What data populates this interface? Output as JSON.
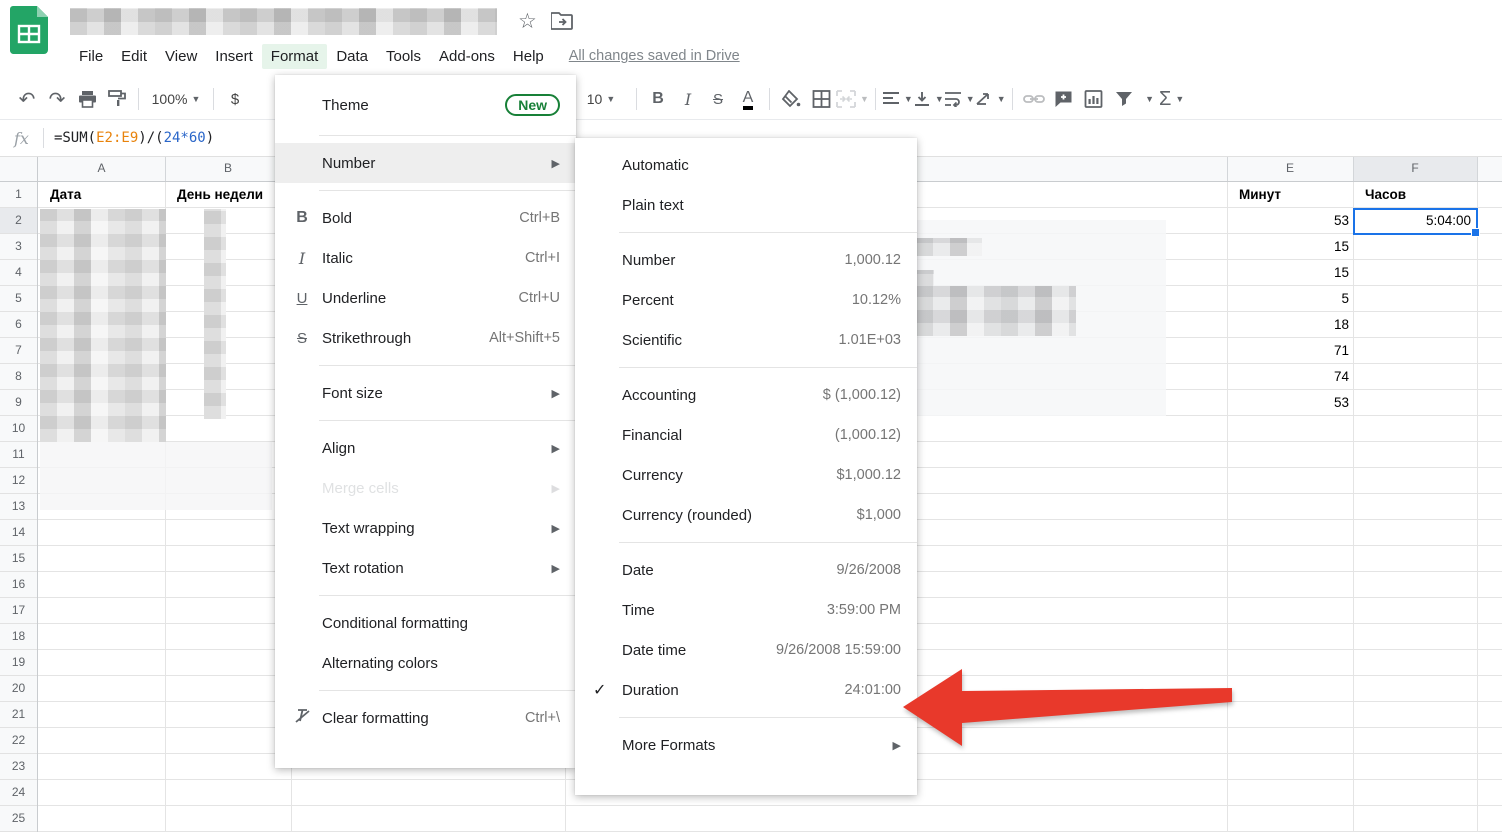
{
  "colors": {
    "accent_blue": "#1a73e8",
    "menu_active_green_bg": "#e6f4ea",
    "badge_green": "#188038",
    "arrow_red": "#e8392b",
    "formula_range_orange": "#e8830c",
    "formula_number_blue": "#2a66c9",
    "menu_highlight_gray": "#eeeeee"
  },
  "menubar": {
    "items": {
      "file": "File",
      "edit": "Edit",
      "view": "View",
      "insert": "Insert",
      "format": "Format",
      "data": "Data",
      "tools": "Tools",
      "addons": "Add-ons",
      "help": "Help"
    },
    "status": "All changes saved in Drive"
  },
  "toolbar": {
    "zoom_value": "100%",
    "currency_symbol": "$",
    "font_size_value": "10",
    "bold": "B",
    "italic": "I",
    "strikethrough": "S",
    "text_color": "A",
    "functions_sigma": "Σ"
  },
  "formula_bar": {
    "fx_label": "fx",
    "parts": {
      "p1": "=SUM(",
      "p2": "E2:E9",
      "p3": ")/(",
      "p4": "24*60",
      "p5": ")"
    }
  },
  "format_menu": {
    "items": {
      "theme": {
        "label": "Theme",
        "badge": "New"
      },
      "number": {
        "label": "Number"
      },
      "bold": {
        "label": "Bold",
        "shortcut": "Ctrl+B"
      },
      "italic": {
        "label": "Italic",
        "shortcut": "Ctrl+I"
      },
      "underline": {
        "label": "Underline",
        "shortcut": "Ctrl+U"
      },
      "strikethrough": {
        "label": "Strikethrough",
        "shortcut": "Alt+Shift+5"
      },
      "font_size": {
        "label": "Font size"
      },
      "align": {
        "label": "Align"
      },
      "merge_cells": {
        "label": "Merge cells"
      },
      "text_wrapping": {
        "label": "Text wrapping"
      },
      "text_rotation": {
        "label": "Text rotation"
      },
      "conditional_formatting": {
        "label": "Conditional formatting"
      },
      "alternating_colors": {
        "label": "Alternating colors"
      },
      "clear_formatting": {
        "label": "Clear formatting",
        "shortcut": "Ctrl+\\"
      }
    }
  },
  "number_menu": {
    "items": {
      "automatic": {
        "label": "Automatic"
      },
      "plain_text": {
        "label": "Plain text"
      },
      "number": {
        "label": "Number",
        "example": "1,000.12"
      },
      "percent": {
        "label": "Percent",
        "example": "10.12%"
      },
      "scientific": {
        "label": "Scientific",
        "example": "1.01E+03"
      },
      "accounting": {
        "label": "Accounting",
        "example": "$ (1,000.12)"
      },
      "financial": {
        "label": "Financial",
        "example": "(1,000.12)"
      },
      "currency": {
        "label": "Currency",
        "example": "$1,000.12"
      },
      "currency_rounded": {
        "label": "Currency (rounded)",
        "example": "$1,000"
      },
      "date": {
        "label": "Date",
        "example": "9/26/2008"
      },
      "time": {
        "label": "Time",
        "example": "3:59:00 PM"
      },
      "date_time": {
        "label": "Date time",
        "example": "9/26/2008 15:59:00"
      },
      "duration": {
        "label": "Duration",
        "example": "24:01:00",
        "checked": "✓"
      },
      "more_formats": {
        "label": "More Formats"
      }
    }
  },
  "sheet": {
    "visible_columns": {
      "a": "A",
      "b": "B",
      "e": "E",
      "f": "F"
    },
    "row_numbers": [
      "1",
      "2",
      "3",
      "4",
      "5",
      "6",
      "7",
      "8",
      "9",
      "10",
      "11",
      "12",
      "13",
      "14",
      "15",
      "16",
      "17",
      "18",
      "19",
      "20",
      "21",
      "22",
      "23",
      "24",
      "25"
    ],
    "headers": {
      "a": "Дата",
      "b": "День недели",
      "e": "Минут",
      "f": "Часов"
    },
    "minutes": [
      "53",
      "15",
      "15",
      "5",
      "18",
      "71",
      "74",
      "53"
    ],
    "selected_cell_value": "5:04:00"
  }
}
